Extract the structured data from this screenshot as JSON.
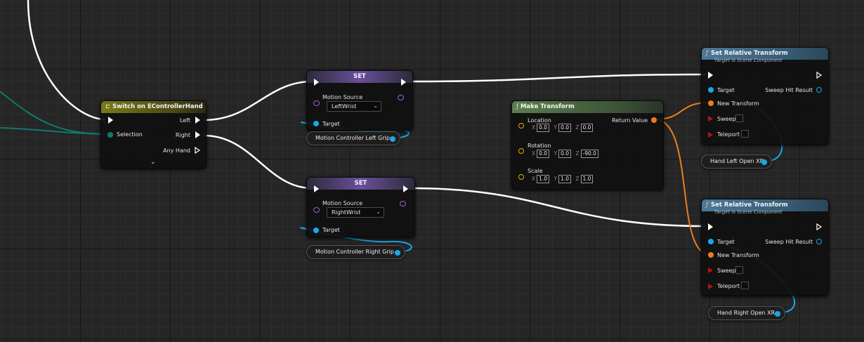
{
  "switch_node": {
    "title": "Switch on EControllerHand",
    "input_label": "Selection",
    "outputs": [
      "Left",
      "Right",
      "Any Hand"
    ]
  },
  "set_left": {
    "title": "SET",
    "motion_source_label": "Motion Source",
    "motion_source_value": "LeftWrist",
    "target_label": "Target",
    "variable_label": "Motion Controller Left Grip"
  },
  "set_right": {
    "title": "SET",
    "motion_source_label": "Motion Source",
    "motion_source_value": "RightWrist",
    "target_label": "Target",
    "variable_label": "Motion Controller Right Grip"
  },
  "make_transform": {
    "title": "Make Transform",
    "return_label": "Return Value",
    "location_label": "Location",
    "location": {
      "x": "0.0",
      "y": "0.0",
      "z": "0.0"
    },
    "rotation_label": "Rotation",
    "rotation": {
      "x": "0.0",
      "y": "0.0",
      "z": "-90.0"
    },
    "scale_label": "Scale",
    "scale": {
      "x": "1.0",
      "y": "1.0",
      "z": "1.0"
    },
    "axis_x": "X",
    "axis_y": "Y",
    "axis_z": "Z"
  },
  "set_rel_top": {
    "title": "Set Relative Transform",
    "subtitle": "Target is Scene Component",
    "target_label": "Target",
    "sweep_result_label": "Sweep Hit Result",
    "new_transform_label": "New Transform",
    "sweep_label": "Sweep",
    "teleport_label": "Teleport",
    "variable_label": "Hand Left Open XR"
  },
  "set_rel_bottom": {
    "title": "Set Relative Transform",
    "subtitle": "Target is Scene Component",
    "target_label": "Target",
    "sweep_result_label": "Sweep Hit Result",
    "new_transform_label": "New Transform",
    "sweep_label": "Sweep",
    "teleport_label": "Teleport",
    "variable_label": "Hand Right Open XR"
  },
  "colors": {
    "exec_wire": "#ffffff",
    "object_wire": "#1aa7ec",
    "transform_wire": "#f07d19",
    "enum_wire": "#0e7a6e"
  }
}
